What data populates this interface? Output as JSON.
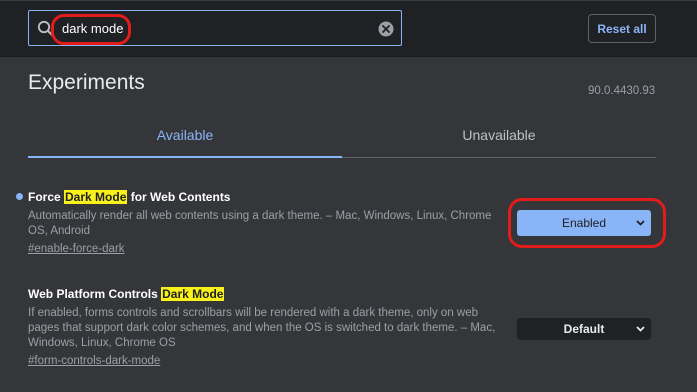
{
  "search": {
    "value": "dark mode",
    "clear_icon": "clear-circle-icon",
    "search_icon": "search-icon"
  },
  "toolbar": {
    "reset_label": "Reset all"
  },
  "page": {
    "title": "Experiments",
    "version": "90.0.4430.93"
  },
  "tabs": [
    {
      "label": "Available",
      "active": true
    },
    {
      "label": "Unavailable",
      "active": false
    }
  ],
  "experiments": [
    {
      "title_before": "Force ",
      "title_highlight": "Dark Mode",
      "title_after": " for Web Contents",
      "description": "Automatically render all web contents using a dark theme. – Mac, Windows, Linux, Chrome OS, Android",
      "link": "#enable-force-dark",
      "selected": "Enabled",
      "modified": true
    },
    {
      "title_before": "Web Platform Controls ",
      "title_highlight": "Dark Mode",
      "title_after": "",
      "description": "If enabled, forms controls and scrollbars will be rendered with a dark theme, only on web pages that support dark color schemes, and when the OS is switched to dark theme. – Mac, Windows, Linux, Chrome OS",
      "link": "#form-controls-dark-mode",
      "selected": "Default",
      "modified": false
    }
  ],
  "colors": {
    "accent": "#8ab4f8",
    "background": "#35363a",
    "header": "#202124",
    "highlight": "#f8f11b",
    "annotation": "#e21b1b"
  }
}
